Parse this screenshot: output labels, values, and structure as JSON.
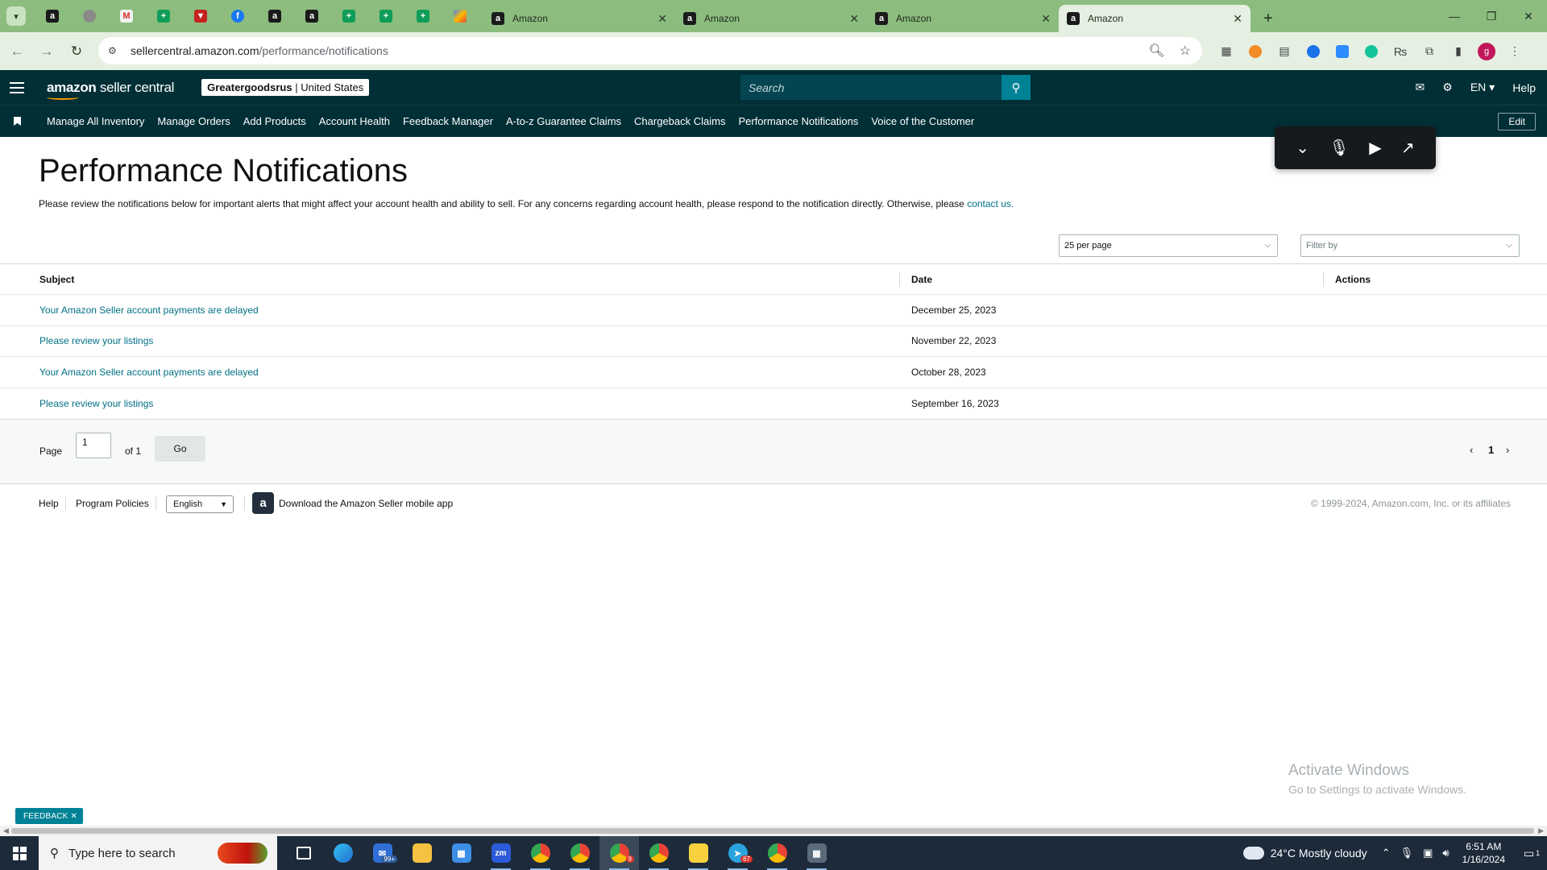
{
  "browser": {
    "tabs": [
      {
        "title": "Amazon",
        "active": false
      },
      {
        "title": "Amazon",
        "active": false
      },
      {
        "title": "Amazon",
        "active": false
      },
      {
        "title": "Amazon",
        "active": true
      }
    ],
    "url_domain": "sellercentral.amazon.com",
    "url_path": "/performance/notifications"
  },
  "header": {
    "logo_bold": "amazon",
    "logo_rest": " seller central",
    "store_name": "Greatergoodsrus",
    "store_region": " | United States",
    "search_placeholder": "Search",
    "lang": "EN",
    "help": "Help"
  },
  "nav": {
    "items": [
      "Manage All Inventory",
      "Manage Orders",
      "Add Products",
      "Account Health",
      "Feedback Manager",
      "A-to-z Guarantee Claims",
      "Chargeback Claims",
      "Performance Notifications",
      "Voice of the Customer"
    ],
    "edit": "Edit"
  },
  "page": {
    "title": "Performance Notifications",
    "intro": "Please review the notifications below for important alerts that might affect your account health and ability to sell. For any concerns regarding account health, please respond to the notification directly. Otherwise, please ",
    "intro_link": "contact us.",
    "per_page": "25 per page",
    "filter_placeholder": "Filter by"
  },
  "table": {
    "columns": [
      "Subject",
      "Date",
      "Actions"
    ],
    "rows": [
      {
        "subject": "Your Amazon Seller account payments are delayed",
        "date": "December 25, 2023"
      },
      {
        "subject": "Please review your listings",
        "date": "November 22, 2023"
      },
      {
        "subject": "Your Amazon Seller account payments are delayed",
        "date": "October 28, 2023"
      },
      {
        "subject": "Please review your listings",
        "date": "September 16, 2023"
      }
    ]
  },
  "pager": {
    "page_label": "Page",
    "page_value": "1",
    "of_label": "of 1",
    "go": "Go",
    "current": "1"
  },
  "footer": {
    "help": "Help",
    "policies": "Program Policies",
    "language": "English",
    "app": "Download the Amazon Seller mobile app",
    "copyright": "© 1999-2024, Amazon.com, Inc. or its affiliates"
  },
  "watermark": {
    "line1": "Activate Windows",
    "line2": "Go to Settings to activate Windows."
  },
  "feedback": "FEEDBACK ✕",
  "taskbar": {
    "search_placeholder": "Type here to search",
    "weather": "24°C  Mostly cloudy",
    "time": "6:51 AM",
    "date": "1/16/2024",
    "mail_badge": "99+",
    "chrome_badge": "9",
    "telegram_badge": "67",
    "notif_count": "1"
  }
}
